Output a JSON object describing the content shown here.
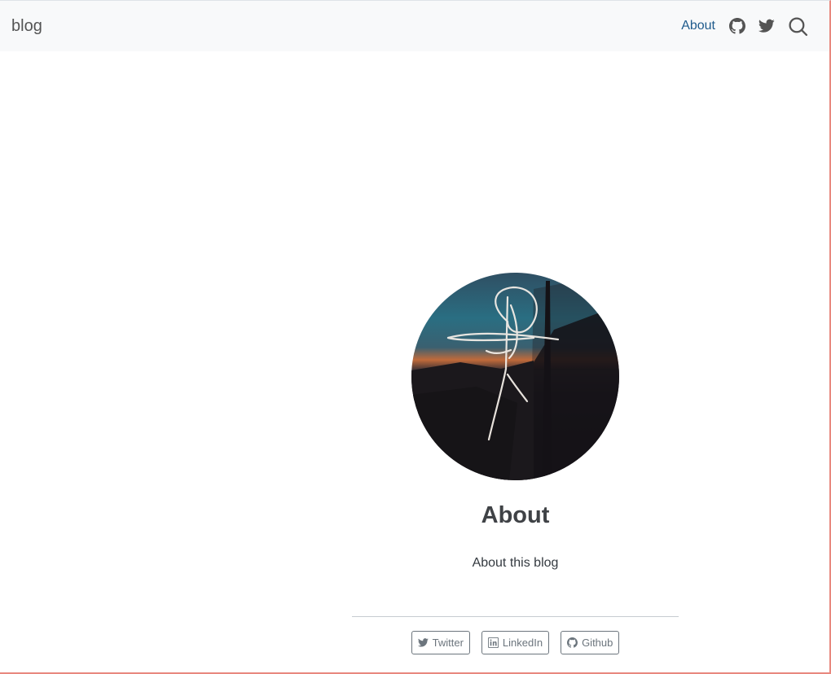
{
  "navbar": {
    "brand": "blog",
    "about_label": "About",
    "icons": [
      "github-icon",
      "twitter-icon",
      "search-icon"
    ]
  },
  "about": {
    "title": "About",
    "description": "About this blog",
    "links": [
      {
        "label": "Twitter",
        "icon": "twitter-icon"
      },
      {
        "label": "LinkedIn",
        "icon": "linkedin-icon"
      },
      {
        "label": "Github",
        "icon": "github-icon"
      }
    ]
  },
  "colors": {
    "navbar_bg": "#f8f9fa",
    "link": "#1f5b8c",
    "text": "#343a40",
    "button_border": "#6c757d",
    "frame_accent": "#e8887e"
  }
}
